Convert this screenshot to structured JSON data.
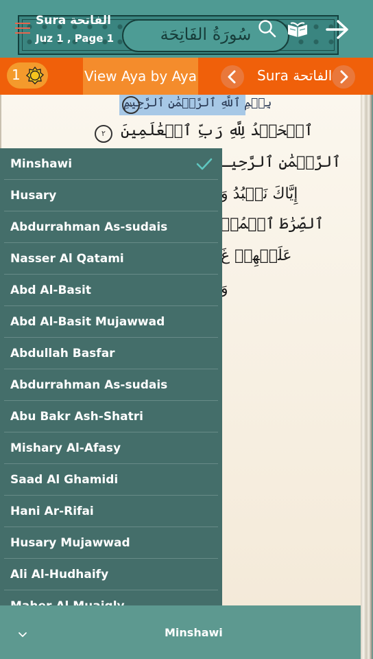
{
  "header": {
    "title": "Sura الفاتحة",
    "subtitle": "Juz 1 , Page 1",
    "banner_text": "سُورَةُ الفَاتِحَة"
  },
  "toolbar": {
    "badge_count": "1",
    "view_label": "View Aya by Aya",
    "sura_label": "Sura الفاتحة"
  },
  "quran": {
    "bismillah": "بِسۡمِ ٱللَّهِ ٱلرَّحۡمَٰنِ ٱلرَّحِيمِ",
    "bismillah_number": "١",
    "verse2": "ٱلۡحَمۡدُ لِلَّهِ رَبِّ ٱلۡعَٰلَمِينَ",
    "verse2_number": "٢",
    "verse3": "ٱلرَّحۡمَٰنِ ٱلرَّحِيـ",
    "verse4": "إِيَّاكَ نَعۡبُدُ وَ",
    "verse5": "ٱلصِّرَٰطَ ٱلۡمُسۡ",
    "verse6": "عَلَيۡهِمۡ غَ",
    "verse7": "وَ"
  },
  "reciters": {
    "selected": "Minshawi",
    "items": [
      {
        "label": "Minshawi"
      },
      {
        "label": "Husary"
      },
      {
        "label": "Abdurrahman As-sudais"
      },
      {
        "label": "Nasser Al Qatami"
      },
      {
        "label": "Abd Al-Basit"
      },
      {
        "label": "Abd Al-Basit Mujawwad"
      },
      {
        "label": "Abdullah Basfar"
      },
      {
        "label": "Abdurrahman As-sudais"
      },
      {
        "label": "Abu Bakr Ash-Shatri"
      },
      {
        "label": "Mishary Al-Afasy"
      },
      {
        "label": "Saad Al Ghamidi"
      },
      {
        "label": "Hani Ar-Rifai"
      },
      {
        "label": "Husary Mujawwad"
      },
      {
        "label": "Ali Al-Hudhaify"
      },
      {
        "label": "Maher Al Muaiqly"
      }
    ]
  },
  "bottom_bar": {
    "reciter_label": "Minshawi"
  },
  "icons": {
    "menu": "menu-icon",
    "search": "search-icon",
    "book": "open-book-icon",
    "forward": "arrow-right-icon",
    "sun": "sun-icon",
    "prev": "chevron-left-icon",
    "next": "chevron-right-icon",
    "check": "check-icon",
    "collapse": "chevron-down-icon"
  },
  "colors": {
    "header": "#4f9a93",
    "toolbar": "#f0600a",
    "dropdown": "#446e6a",
    "check": "#5fc7c0",
    "highlight": "#a7c8e6"
  }
}
